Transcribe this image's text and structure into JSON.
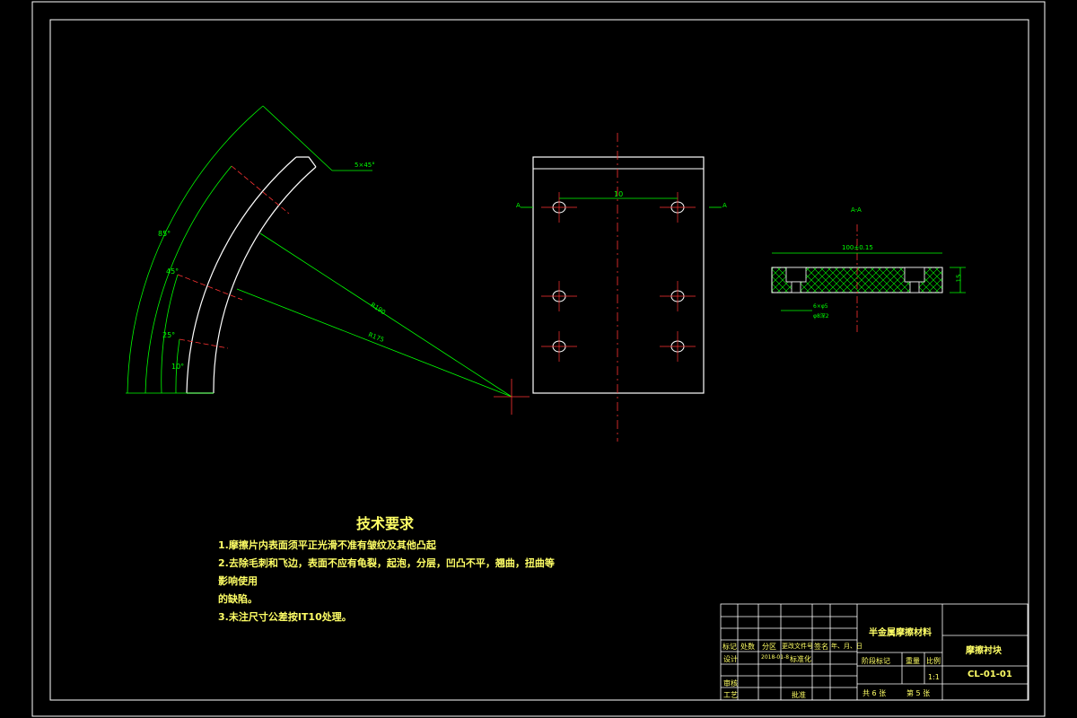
{
  "drawing": {
    "chamfer_note": "5×45°",
    "angles": [
      "85°",
      "45°",
      "25°",
      "10°"
    ],
    "radii": [
      "R190",
      "R175"
    ],
    "hole_spacing": "10",
    "section_marks": [
      "A",
      "A"
    ],
    "section_title": "A-A",
    "section_width": "100±0.15",
    "section_height": "15",
    "section_hole_note": "6×φ5",
    "section_hole_note2": "φ8深2"
  },
  "requirements": {
    "title": "技术要求",
    "items": [
      "1.摩擦片内表面须平正光滑不准有皱纹及其他凸起",
      "2.去除毛刺和飞边，表面不应有龟裂，起泡，分层，凹凸不平，翘曲，扭曲等影响使用",
      "的缺陷。",
      "3.未注尺寸公差按IT10处理。"
    ]
  },
  "title_block": {
    "project": "半金属摩擦材料",
    "part_name": "摩擦衬块",
    "drawing_no": "CL-01-01",
    "scale_label": "比例",
    "scale": "1:1",
    "stage_label": "阶段标记",
    "weight_label": "重量",
    "sheets_total": "共 6 张",
    "sheet_no": "第 5 张",
    "row_headers": [
      "标记",
      "处数",
      "分区",
      "更改文件号",
      "签名",
      "年、月、日"
    ],
    "designer": "设计",
    "design_date": "2018-01-8",
    "standard": "标准化",
    "reviewer": "审核",
    "process": "工艺",
    "approve": "批准"
  }
}
